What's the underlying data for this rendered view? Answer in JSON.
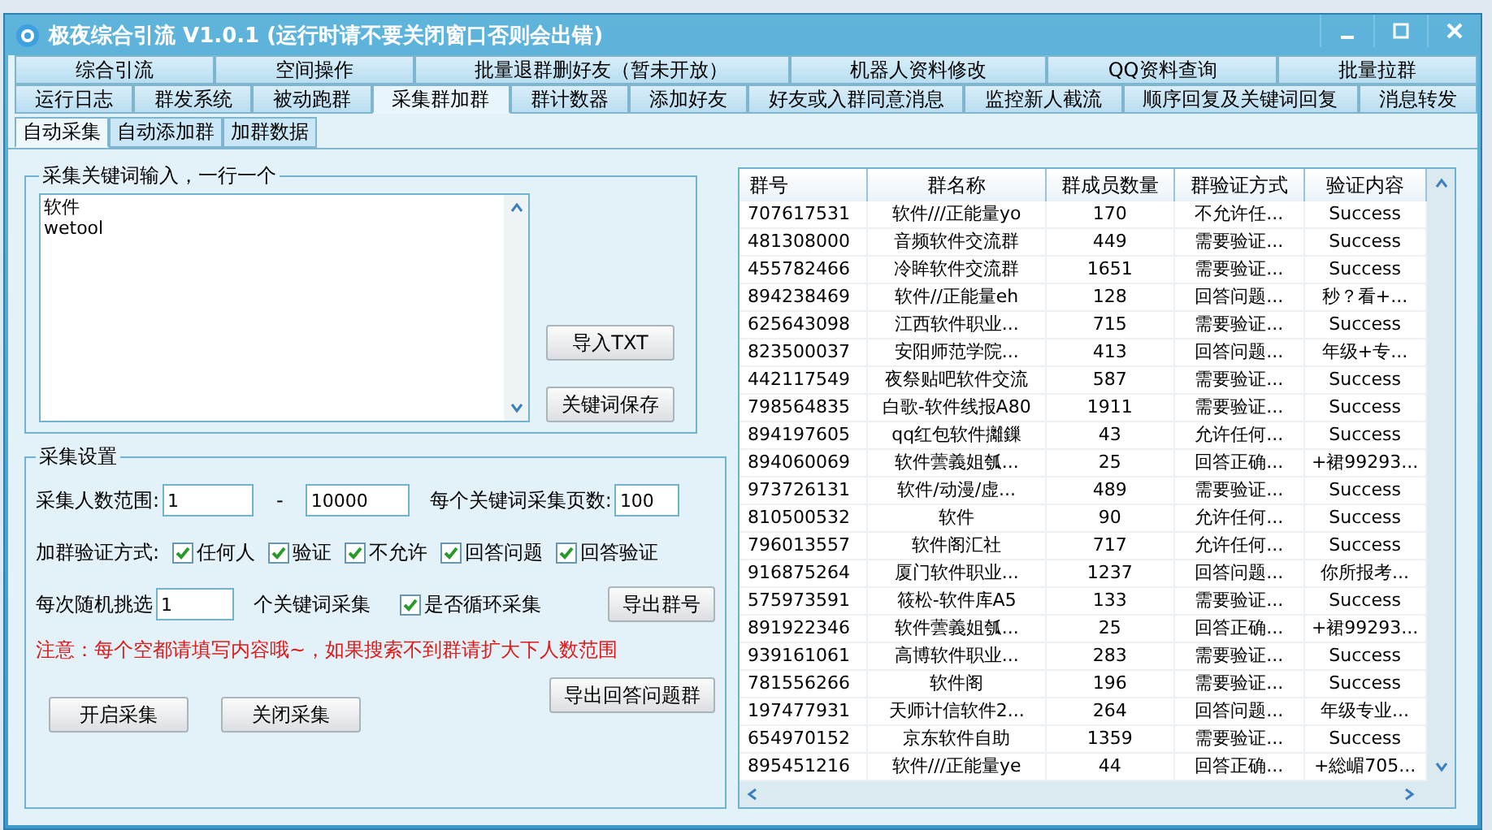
{
  "window": {
    "title": "极夜综合引流 V1.0.1 (运行时请不要关闭窗口否则会出错)"
  },
  "tabs_row_1": [
    {
      "label": "综合引流",
      "selected": false
    },
    {
      "label": "空间操作",
      "selected": false
    },
    {
      "label": "批量退群删好友（暂未开放）",
      "selected": false
    },
    {
      "label": "机器人资料修改",
      "selected": false
    },
    {
      "label": "QQ资料查询",
      "selected": false
    },
    {
      "label": "批量拉群",
      "selected": false
    }
  ],
  "tabs_row_2": [
    {
      "label": "运行日志",
      "selected": false
    },
    {
      "label": "群发系统",
      "selected": false
    },
    {
      "label": "被动跑群",
      "selected": false
    },
    {
      "label": "采集群加群",
      "selected": true
    },
    {
      "label": "群计数器",
      "selected": false
    },
    {
      "label": "添加好友",
      "selected": false
    },
    {
      "label": "好友或入群同意消息",
      "selected": false
    },
    {
      "label": "监控新人截流",
      "selected": false
    },
    {
      "label": "顺序回复及关键词回复",
      "selected": false
    },
    {
      "label": "消息转发",
      "selected": false
    }
  ],
  "sub_tabs": [
    {
      "label": "自动采集",
      "selected": true
    },
    {
      "label": "自动添加群",
      "selected": false
    },
    {
      "label": "加群数据",
      "selected": false
    }
  ],
  "keyword_group": {
    "title": "采集关键词输入，一行一个",
    "keywords": [
      "软件",
      "wetool"
    ],
    "buttons": [
      "导入TXT",
      "关键词保存"
    ]
  },
  "settings_group": {
    "title": "采集设置",
    "range_label": "采集人数范围:",
    "range_min": "1",
    "range_sep": "-",
    "range_max": "10000",
    "pages_label": "每个关键词采集页数:",
    "pages": "100",
    "verify_label": "加群验证方式:",
    "verify_options": [
      {
        "label": "任何人",
        "checked": true
      },
      {
        "label": "验证",
        "checked": true
      },
      {
        "label": "不允许",
        "checked": true
      },
      {
        "label": "回答问题",
        "checked": true
      },
      {
        "label": "回答验证",
        "checked": true
      }
    ],
    "random_label": "每次随机挑选",
    "random_count": "1",
    "random_suffix": "个关键词采集",
    "loop": {
      "label": "是否循环采集",
      "checked": true
    },
    "export_button": "导出群号",
    "notice": "注意：每个空都请填写内容哦~，如果搜索不到群请扩大下人数范围",
    "start_button": "开启采集",
    "stop_button": "关闭采集",
    "export_answer_button": "导出回答问题群"
  },
  "table": {
    "columns": [
      "群号",
      "群名称",
      "群成员数量",
      "群验证方式",
      "验证内容"
    ],
    "rows": [
      [
        "707617531",
        "软件///正能量yo",
        "170",
        "不允许任...",
        "Success"
      ],
      [
        "481308000",
        "音频软件交流群",
        "449",
        "需要验证...",
        "Success"
      ],
      [
        "455782466",
        "冷眸软件交流群",
        "1651",
        "需要验证...",
        "Success"
      ],
      [
        "894238469",
        "软件//正能量eh",
        "128",
        "回答问题...",
        "秒？看+..."
      ],
      [
        "625643098",
        "江西软件职业...",
        "715",
        "需要验证...",
        "Success"
      ],
      [
        "823500037",
        "安阳师范学院...",
        "413",
        "回答问题...",
        "年级+专..."
      ],
      [
        "442117549",
        "夜祭贴吧软件交流",
        "587",
        "需要验证...",
        "Success"
      ],
      [
        "798564835",
        "白歌-软件线报A80",
        "1911",
        "需要验证...",
        "Success"
      ],
      [
        "894197605",
        "qq红包软件攡鏁",
        "43",
        "允许任何...",
        "Success"
      ],
      [
        "894060069",
        "软件蕓義姐瓠...",
        "25",
        "回答正确...",
        "+裙99293..."
      ],
      [
        "973726131",
        "软件/动漫/虚...",
        "489",
        "需要验证...",
        "Success"
      ],
      [
        "810500532",
        "软件",
        "90",
        "允许任何...",
        "Success"
      ],
      [
        "796013557",
        "软件阁汇社",
        "717",
        "允许任何...",
        "Success"
      ],
      [
        "916875264",
        "厦门软件职业...",
        "1237",
        "回答问题...",
        "你所报考..."
      ],
      [
        "575973591",
        "筱松-软件库A5",
        "133",
        "需要验证...",
        "Success"
      ],
      [
        "891922346",
        "软件蕓義姐瓠...",
        "25",
        "回答正确...",
        "+裙99293..."
      ],
      [
        "939161061",
        "高博软件职业...",
        "283",
        "需要验证...",
        "Success"
      ],
      [
        "781556266",
        "软件阁",
        "196",
        "需要验证...",
        "Success"
      ],
      [
        "197477931",
        "天师计信软件2...",
        "264",
        "回答问题...",
        "年级专业..."
      ],
      [
        "654970152",
        "京东软件自助",
        "1359",
        "需要验证...",
        "Success"
      ],
      [
        "895451216",
        "软件///正能量ye",
        "44",
        "回答正确...",
        "+総嵋705..."
      ]
    ]
  }
}
